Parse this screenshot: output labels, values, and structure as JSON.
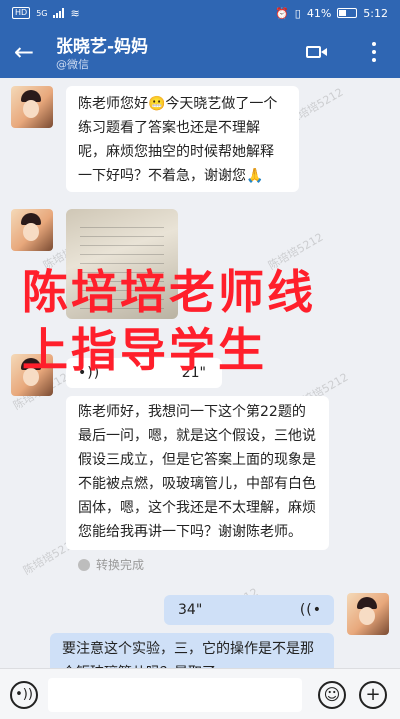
{
  "status_bar": {
    "hd_label": "HD",
    "signal_label": "5G",
    "battery_text": "41%",
    "time": "5:12"
  },
  "header": {
    "title": "张晓艺-妈妈",
    "subtitle": "@微信"
  },
  "messages": {
    "msg1": "陈老师您好😬今天晓艺做了一个练习题看了答案也还是不理解呢，麻烦您抽空的时候帮她解释一下好吗？不着急，谢谢您🙏",
    "voice1_duration": "21\"",
    "voice1_transcript": "陈老师好，我想问一下这个第22题的最后一问，嗯，就是这个假设，三他说假设三成立，但是它答案上面的现象是不能被点燃，吸玻璃管儿，中部有白色固体，嗯，这个我还是不太理解，麻烦您能给我再讲一下吗？谢谢陈老师。",
    "convert_label": "转换完成",
    "voice2_duration": "34\"",
    "reply_partial": "要注意这个实验，三，它的操作是不是那个钜玻璃管儿吗？是取了"
  },
  "overlay_text": {
    "line1": "陈培培老师线",
    "line2": "上指导学生"
  },
  "watermark_text": "陈培培5212",
  "icons": {
    "back": "←",
    "voice_wave": "•))",
    "voice_wave_rev": "((•",
    "emoji": "☺",
    "add": "+"
  },
  "colors": {
    "header_bg": "#2f66b3",
    "overlay_red": "#ff1f2b",
    "sent_bubble": "#cfe0f7"
  }
}
